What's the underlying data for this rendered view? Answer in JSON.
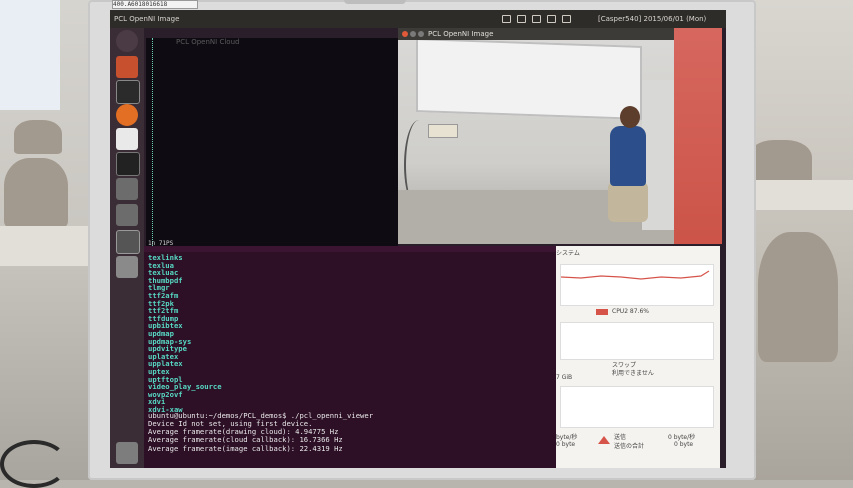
{
  "sticker_text": "400.A6018016618",
  "topbar": {
    "title": "PCL OpenNI Image",
    "clock": "[Casper540] 2015/06/01 (Mon) 16:25:20"
  },
  "termA": {
    "title": "PCL OpenNI Cloud",
    "bottom_line": "1n 71PS"
  },
  "pcl_window": {
    "title": "PCL OpenNI Image"
  },
  "terminal": {
    "commands": [
      "texlinks",
      "texlua",
      "texluac",
      "thumbpdf",
      "tlmgr",
      "ttf2afm",
      "ttf2pk",
      "ttf2tfm",
      "ttfdump",
      "upbibtex",
      "updmap",
      "updmap-sys",
      "updvitype",
      "uplatex",
      "upplatex",
      "uptex",
      "uptftopl",
      "video_play_source",
      "wovp2ovf",
      "xdvi",
      "xdvi-xaw"
    ],
    "prompt": "ubuntu@ubuntu:~/demos/PCL_demos$ ./pcl_openni_viewer",
    "output": [
      "Device Id not set, using first device.",
      "Average framerate(drawing cloud): 4.94775 Hz",
      "Average framerate(cloud callback): 16.7366 Hz",
      "Average framerate(image callback): 22.4319 Hz"
    ]
  },
  "sysmon": {
    "tab": "システム",
    "cpu_label": "CPU2 87.6%",
    "swap_title": "スワップ",
    "swap_status": "利用できません",
    "gb_label": "7 GiB",
    "send_label": "送信",
    "send_total_label": "送信の合計",
    "send_rate": "0 byte/秒",
    "send_total": "0 byte",
    "recv_rate": "byte/秒",
    "recv_total": "0 byte"
  },
  "colors": {
    "terminal_bg": "#2d0f26",
    "command_text": "#57d9c4",
    "cpu_line": "#d6534a",
    "launcher": "#3b2d36"
  }
}
